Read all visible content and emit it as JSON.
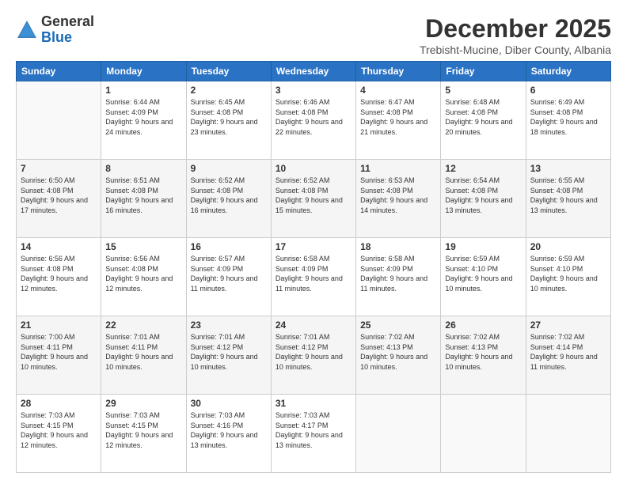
{
  "logo": {
    "general": "General",
    "blue": "Blue"
  },
  "header": {
    "month_year": "December 2025",
    "location": "Trebisht-Mucine, Diber County, Albania"
  },
  "days_of_week": [
    "Sunday",
    "Monday",
    "Tuesday",
    "Wednesday",
    "Thursday",
    "Friday",
    "Saturday"
  ],
  "weeks": [
    [
      {
        "day": "",
        "sunrise": "",
        "sunset": "",
        "daylight": ""
      },
      {
        "day": "1",
        "sunrise": "Sunrise: 6:44 AM",
        "sunset": "Sunset: 4:09 PM",
        "daylight": "Daylight: 9 hours and 24 minutes."
      },
      {
        "day": "2",
        "sunrise": "Sunrise: 6:45 AM",
        "sunset": "Sunset: 4:08 PM",
        "daylight": "Daylight: 9 hours and 23 minutes."
      },
      {
        "day": "3",
        "sunrise": "Sunrise: 6:46 AM",
        "sunset": "Sunset: 4:08 PM",
        "daylight": "Daylight: 9 hours and 22 minutes."
      },
      {
        "day": "4",
        "sunrise": "Sunrise: 6:47 AM",
        "sunset": "Sunset: 4:08 PM",
        "daylight": "Daylight: 9 hours and 21 minutes."
      },
      {
        "day": "5",
        "sunrise": "Sunrise: 6:48 AM",
        "sunset": "Sunset: 4:08 PM",
        "daylight": "Daylight: 9 hours and 20 minutes."
      },
      {
        "day": "6",
        "sunrise": "Sunrise: 6:49 AM",
        "sunset": "Sunset: 4:08 PM",
        "daylight": "Daylight: 9 hours and 18 minutes."
      }
    ],
    [
      {
        "day": "7",
        "sunrise": "Sunrise: 6:50 AM",
        "sunset": "Sunset: 4:08 PM",
        "daylight": "Daylight: 9 hours and 17 minutes."
      },
      {
        "day": "8",
        "sunrise": "Sunrise: 6:51 AM",
        "sunset": "Sunset: 4:08 PM",
        "daylight": "Daylight: 9 hours and 16 minutes."
      },
      {
        "day": "9",
        "sunrise": "Sunrise: 6:52 AM",
        "sunset": "Sunset: 4:08 PM",
        "daylight": "Daylight: 9 hours and 16 minutes."
      },
      {
        "day": "10",
        "sunrise": "Sunrise: 6:52 AM",
        "sunset": "Sunset: 4:08 PM",
        "daylight": "Daylight: 9 hours and 15 minutes."
      },
      {
        "day": "11",
        "sunrise": "Sunrise: 6:53 AM",
        "sunset": "Sunset: 4:08 PM",
        "daylight": "Daylight: 9 hours and 14 minutes."
      },
      {
        "day": "12",
        "sunrise": "Sunrise: 6:54 AM",
        "sunset": "Sunset: 4:08 PM",
        "daylight": "Daylight: 9 hours and 13 minutes."
      },
      {
        "day": "13",
        "sunrise": "Sunrise: 6:55 AM",
        "sunset": "Sunset: 4:08 PM",
        "daylight": "Daylight: 9 hours and 13 minutes."
      }
    ],
    [
      {
        "day": "14",
        "sunrise": "Sunrise: 6:56 AM",
        "sunset": "Sunset: 4:08 PM",
        "daylight": "Daylight: 9 hours and 12 minutes."
      },
      {
        "day": "15",
        "sunrise": "Sunrise: 6:56 AM",
        "sunset": "Sunset: 4:08 PM",
        "daylight": "Daylight: 9 hours and 12 minutes."
      },
      {
        "day": "16",
        "sunrise": "Sunrise: 6:57 AM",
        "sunset": "Sunset: 4:09 PM",
        "daylight": "Daylight: 9 hours and 11 minutes."
      },
      {
        "day": "17",
        "sunrise": "Sunrise: 6:58 AM",
        "sunset": "Sunset: 4:09 PM",
        "daylight": "Daylight: 9 hours and 11 minutes."
      },
      {
        "day": "18",
        "sunrise": "Sunrise: 6:58 AM",
        "sunset": "Sunset: 4:09 PM",
        "daylight": "Daylight: 9 hours and 11 minutes."
      },
      {
        "day": "19",
        "sunrise": "Sunrise: 6:59 AM",
        "sunset": "Sunset: 4:10 PM",
        "daylight": "Daylight: 9 hours and 10 minutes."
      },
      {
        "day": "20",
        "sunrise": "Sunrise: 6:59 AM",
        "sunset": "Sunset: 4:10 PM",
        "daylight": "Daylight: 9 hours and 10 minutes."
      }
    ],
    [
      {
        "day": "21",
        "sunrise": "Sunrise: 7:00 AM",
        "sunset": "Sunset: 4:11 PM",
        "daylight": "Daylight: 9 hours and 10 minutes."
      },
      {
        "day": "22",
        "sunrise": "Sunrise: 7:01 AM",
        "sunset": "Sunset: 4:11 PM",
        "daylight": "Daylight: 9 hours and 10 minutes."
      },
      {
        "day": "23",
        "sunrise": "Sunrise: 7:01 AM",
        "sunset": "Sunset: 4:12 PM",
        "daylight": "Daylight: 9 hours and 10 minutes."
      },
      {
        "day": "24",
        "sunrise": "Sunrise: 7:01 AM",
        "sunset": "Sunset: 4:12 PM",
        "daylight": "Daylight: 9 hours and 10 minutes."
      },
      {
        "day": "25",
        "sunrise": "Sunrise: 7:02 AM",
        "sunset": "Sunset: 4:13 PM",
        "daylight": "Daylight: 9 hours and 10 minutes."
      },
      {
        "day": "26",
        "sunrise": "Sunrise: 7:02 AM",
        "sunset": "Sunset: 4:13 PM",
        "daylight": "Daylight: 9 hours and 10 minutes."
      },
      {
        "day": "27",
        "sunrise": "Sunrise: 7:02 AM",
        "sunset": "Sunset: 4:14 PM",
        "daylight": "Daylight: 9 hours and 11 minutes."
      }
    ],
    [
      {
        "day": "28",
        "sunrise": "Sunrise: 7:03 AM",
        "sunset": "Sunset: 4:15 PM",
        "daylight": "Daylight: 9 hours and 12 minutes."
      },
      {
        "day": "29",
        "sunrise": "Sunrise: 7:03 AM",
        "sunset": "Sunset: 4:15 PM",
        "daylight": "Daylight: 9 hours and 12 minutes."
      },
      {
        "day": "30",
        "sunrise": "Sunrise: 7:03 AM",
        "sunset": "Sunset: 4:16 PM",
        "daylight": "Daylight: 9 hours and 13 minutes."
      },
      {
        "day": "31",
        "sunrise": "Sunrise: 7:03 AM",
        "sunset": "Sunset: 4:17 PM",
        "daylight": "Daylight: 9 hours and 13 minutes."
      },
      {
        "day": "",
        "sunrise": "",
        "sunset": "",
        "daylight": ""
      },
      {
        "day": "",
        "sunrise": "",
        "sunset": "",
        "daylight": ""
      },
      {
        "day": "",
        "sunrise": "",
        "sunset": "",
        "daylight": ""
      }
    ]
  ]
}
